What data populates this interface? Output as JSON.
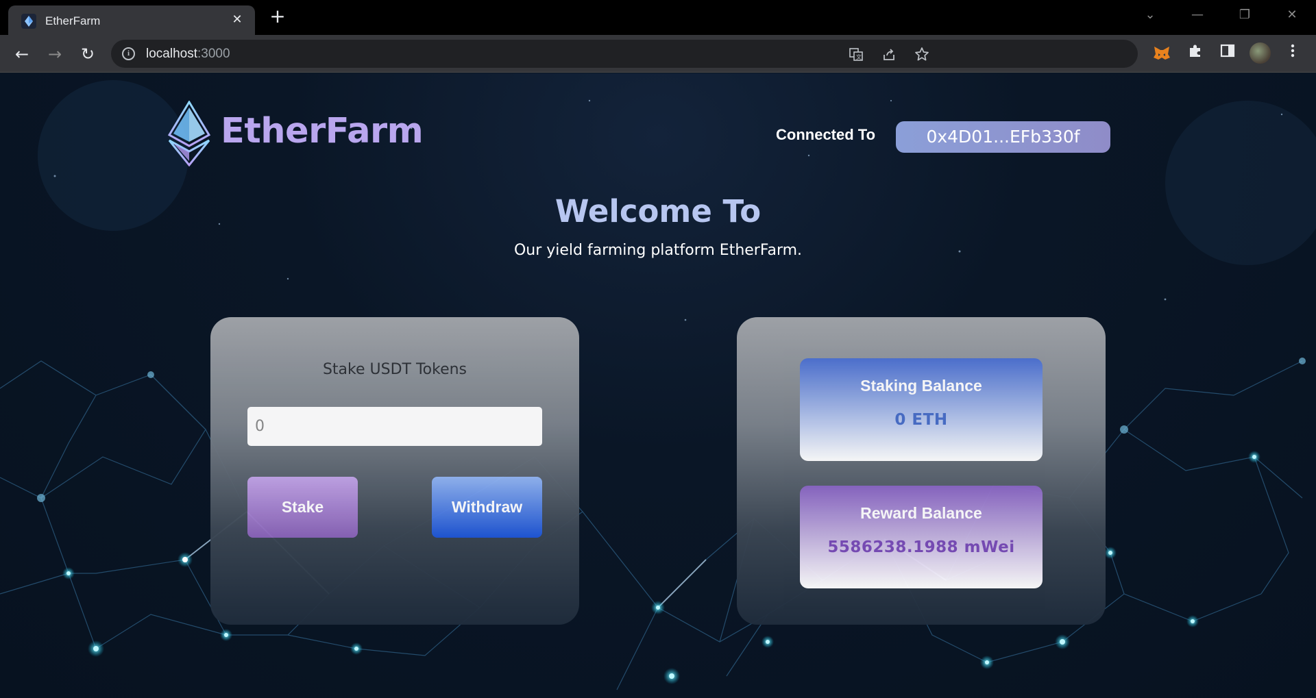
{
  "browser": {
    "tab": {
      "title": "EtherFarm",
      "close_glyph": "✕"
    },
    "new_tab_glyph": "+",
    "window_controls": {
      "dropdown": "⌄",
      "minimize": "—",
      "restore": "❐",
      "close": "✕"
    },
    "nav": {
      "back": "←",
      "forward": "→",
      "reload": "↻"
    },
    "address": {
      "host": "localhost",
      "port": ":3000"
    },
    "icons": [
      "translate-icon",
      "share-icon",
      "bookmark-star-icon",
      "metamask-extension-icon",
      "extensions-puzzle-icon",
      "side-panel-icon",
      "profile-avatar",
      "kebab-menu-icon"
    ]
  },
  "header": {
    "logo_text": "EtherFarm",
    "connected_label": "Connected To",
    "account_address": "0x4D01...EFb330f"
  },
  "hero": {
    "title": "Welcome To",
    "subtitle": "Our yield farming platform EtherFarm."
  },
  "stake_card": {
    "title": "Stake USDT Tokens",
    "input_placeholder": "0",
    "stake_label": "Stake",
    "withdraw_label": "Withdraw"
  },
  "balances": {
    "staking": {
      "label": "Staking Balance",
      "value": "0 ETH"
    },
    "reward": {
      "label": "Reward Balance",
      "value": "5586238.1988 mWei"
    }
  },
  "colors": {
    "logo": "#b9a6ee",
    "address_button": "#8f9ad4",
    "stake_button": "#9f7bcf",
    "withdraw_button": "#2c5fdc",
    "staking_value": "#4a6fc9",
    "reward_value": "#7a4db8"
  }
}
